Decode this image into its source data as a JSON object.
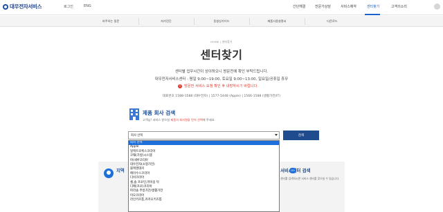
{
  "header": {
    "logo_text": "대우전자서비스",
    "top_links": [
      "로그인",
      "ENG"
    ],
    "nav": [
      "간단해결",
      "전문가상담",
      "서비스예약",
      "센터찾기",
      "고객의소리"
    ],
    "active_nav": "센터찾기"
  },
  "subnav": [
    "자주하는 질문",
    "자가진단",
    "동영상가이드",
    "제품사용설명서",
    "다운로드"
  ],
  "breadcrumb": "HOME  |  센터찾기",
  "page_title": "센터찾기",
  "info": {
    "line1": "센터별 업무시간이 상이하오니 방문전에 확인 부탁드립니다.",
    "line2": "대우전자서비스센터 : 평일 9:00~19:00, 토요일 9:00~13:00, 일요일/공휴일 휴무",
    "warning": "방문전 서비스 요청 확인 후 내방하시기 바랍니다.",
    "phones": "대표번호 1588-1588 (대우전자)  |  1577-5448 (Apple)  |  1566-1588 (생활가전/IT)"
  },
  "search": {
    "title": "제품 회사 검색",
    "desc_prefix": "고객님! 서비스 받으실 ",
    "desc_highlight": "제품의 회사명을 먼저 선택",
    "desc_suffix": "해 주세요.",
    "select_value": "회사 선택",
    "button_label": "검색",
    "options": [
      "회사 선택",
      "Apple",
      "일렉트로룩스코리아",
      "코웨(가방)시스템",
      "아(세루코리아",
      "대우전자(소형가전)",
      "블랙앤데커",
      "에이수스코리아",
      "디비코리아",
      "셀,솔 프로틴,마이옹 탁",
      "디메(프로)코리아",
      "파라솔 주방가전/생활가전",
      "이오코리아",
      "라인키즈통,카카오키즈통"
    ],
    "selected_index": 0
  },
  "cards": {
    "left_title": "지역",
    "right_title": "서비스센터 검색",
    "go_label": "GO",
    "right_desc": "센터를 검색하시면 서비스 센터를 찾으실 수 있습니다."
  }
}
